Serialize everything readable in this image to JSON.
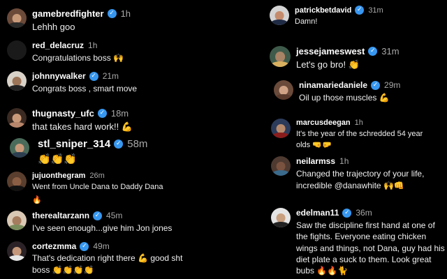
{
  "colors": {
    "background": "#000000",
    "verified_badge": "#3797f0",
    "text": "#f5f5f5",
    "muted": "#a8a8a8"
  },
  "icons": {
    "verified": "verified-badge-icon"
  },
  "comments": [
    {
      "username": "gamebredfighter",
      "time": "1h",
      "verified": true,
      "text": "Lehhh goo",
      "emoji": ""
    },
    {
      "username": "red_delacruz",
      "time": "1h",
      "verified": false,
      "text": "Congratulations boss",
      "emoji": "🙌"
    },
    {
      "username": "johnnywalker",
      "time": "21m",
      "verified": true,
      "text": "Congrats boss , smart move",
      "emoji": ""
    },
    {
      "username": "thugnasty_ufc",
      "time": "18m",
      "verified": true,
      "text": "that takes hard work!!",
      "emoji": "💪"
    },
    {
      "username": "stl_sniper_314",
      "time": "58m",
      "verified": true,
      "text": "",
      "emoji": "👏👏👏"
    },
    {
      "username": "jujuonthegram",
      "time": "26m",
      "verified": false,
      "text": "Went from Uncle Dana to Daddy Dana",
      "emoji": "🔥"
    },
    {
      "username": "therealtarzann",
      "time": "45m",
      "verified": true,
      "text": "I've seen enough...give him Jon jones",
      "emoji": ""
    },
    {
      "username": "cortezmma",
      "time": "49m",
      "verified": true,
      "text": "That's dedication right there",
      "emoji_mid": "💪",
      "text2": "good sht boss",
      "emoji": "👏👏👏👏"
    },
    {
      "username": "patrickbetdavid",
      "time": "31m",
      "verified": true,
      "text": "Damn!",
      "emoji": ""
    },
    {
      "username": "jessejameswest",
      "time": "31m",
      "verified": true,
      "text": "Let's go bro!",
      "emoji": "👏"
    },
    {
      "username": "ninamariedaniele",
      "time": "29m",
      "verified": true,
      "text": "Oil up those muscles",
      "emoji": "💪"
    },
    {
      "username": "marcusdeegan",
      "time": "1h",
      "verified": true,
      "text": "It's the year of the schredded 54 year olds",
      "emoji": "🤜🤛"
    },
    {
      "username": "neilarmss",
      "time": "1h",
      "verified": false,
      "text": "Changed the trajectory of your life, incredible @danawhite",
      "emoji": "🙌👊"
    },
    {
      "username": "edelman11",
      "time": "36m",
      "verified": true,
      "text": "Saw the discipline first hand at one of the fights. Everyone eating chicken wings and things, not Dana, guy had his diet plate a suck to them. Look great bubs",
      "emoji": "🔥🔥🐈"
    }
  ]
}
